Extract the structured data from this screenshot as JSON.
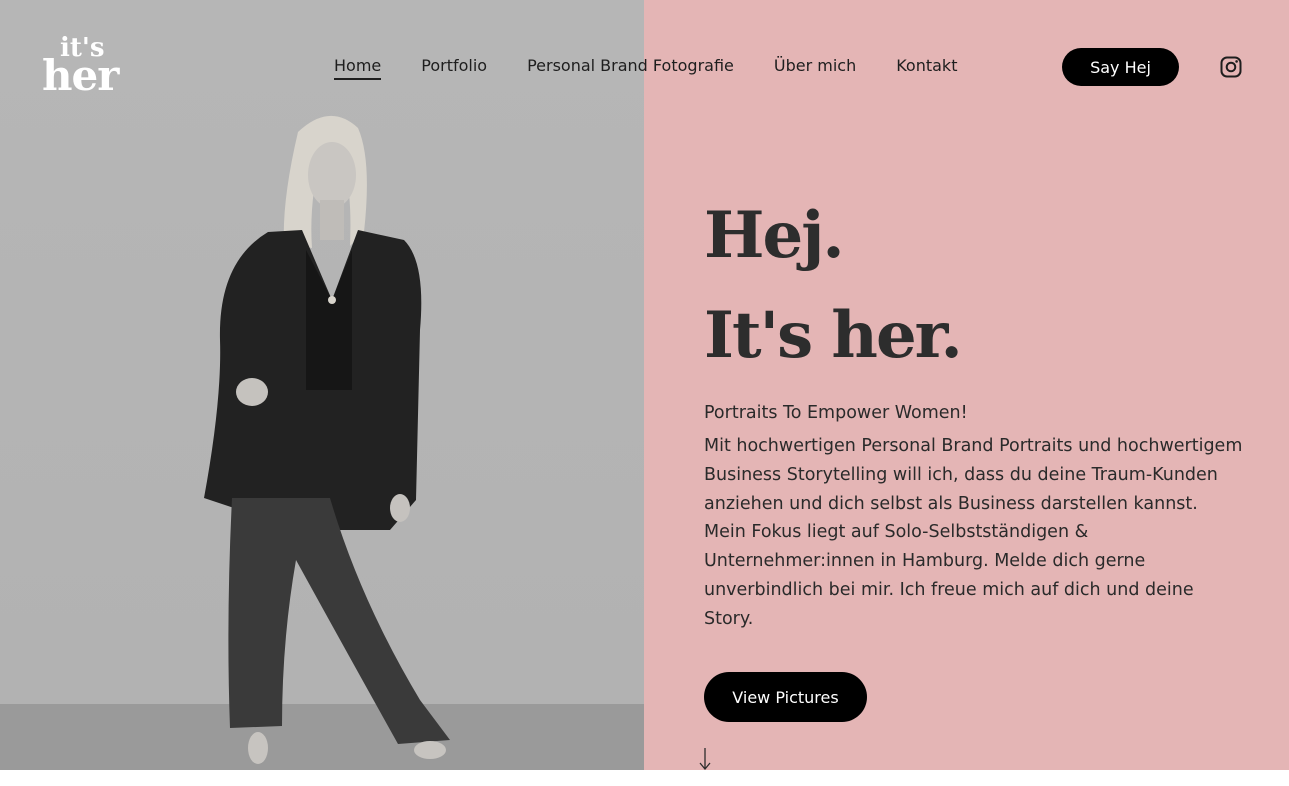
{
  "header": {
    "logo_top": "it's",
    "logo_bottom": "her",
    "nav": [
      {
        "label": "Home",
        "active": true
      },
      {
        "label": "Portfolio",
        "active": false
      },
      {
        "label": "Personal Brand Fotografie",
        "active": false
      },
      {
        "label": "Über mich",
        "active": false
      },
      {
        "label": "Kontakt",
        "active": false
      }
    ],
    "cta_label": "Say Hej",
    "social_icon": "instagram-icon"
  },
  "hero": {
    "heading_line1": "Hej.",
    "heading_line2": "It's her.",
    "tagline": "Portraits To Empower Women!",
    "description": "Mit hochwertigen Personal Brand Portraits und hochwertigem Business Storytelling will ich, dass du deine Traum-Kunden anziehen und dich selbst als Business darstellen kannst. Mein Fokus liegt auf Solo-Selbstständigen & Unternehmer:innen in Hamburg. Melde dich gerne unverbindlich bei mir. Ich freue mich auf dich und deine Story.",
    "button_label": "View Pictures",
    "scroll_icon": "arrow-down-icon",
    "photo_subject": "woman-portrait"
  },
  "colors": {
    "pink_panel": "#e4b5b5",
    "photo_bg": "#b4b4b4",
    "button_bg": "#000000",
    "text": "#2d2d2d"
  }
}
